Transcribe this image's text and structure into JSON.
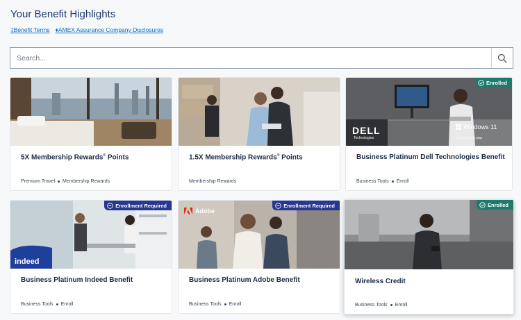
{
  "header": {
    "title": "Your Benefit Highlights"
  },
  "links": [
    {
      "label": "‡Benefit Terms"
    },
    {
      "label": "♦AMEX Assurance Company Disclosures"
    }
  ],
  "search": {
    "placeholder": "Search..."
  },
  "cards": [
    {
      "title": "5X Membership Rewards",
      "title_sup": "®",
      "title_suffix": " Points",
      "tags": [
        "Premium Travel",
        "Membership Rewards"
      ],
      "badge": "",
      "image_desc": "hotel-room-city-view"
    },
    {
      "title": "1.5X Membership Rewards",
      "title_sup": "®",
      "title_suffix": " Points",
      "tags": [
        "Membership Rewards"
      ],
      "badge": "",
      "image_desc": "warehouse-workers"
    },
    {
      "title": "Business Platinum Dell Technologies Benefit",
      "title_sup": "",
      "title_suffix": "",
      "tags": [
        "Business Tools",
        "Enroll"
      ],
      "badge": "Enrolled",
      "image_logo_main": "DELL",
      "image_logo_sub": "Technologies",
      "image_logo_right": "Windows 11",
      "image_logo_right_sub": "Fuel your everyday"
    },
    {
      "title": "Business Platinum Indeed Benefit",
      "title_sup": "",
      "title_suffix": "",
      "tags": [
        "Business Tools",
        "Enroll"
      ],
      "badge": "Enrollment Required",
      "image_logo_main": "indeed"
    },
    {
      "title": "Business Platinum Adobe Benefit",
      "title_sup": "",
      "title_suffix": "",
      "tags": [
        "Business Tools",
        "Enroll"
      ],
      "badge": "Enrollment Required",
      "image_logo_main": "Adobe"
    },
    {
      "title": "Wireless Credit",
      "title_sup": "",
      "title_suffix": "",
      "tags": [
        "Business Tools",
        "Enroll"
      ],
      "badge": "Enrolled"
    }
  ],
  "colors": {
    "enrolled": "#1e7a6a",
    "required": "#27368e",
    "link": "#006fcf",
    "title": "#1a3a78"
  }
}
